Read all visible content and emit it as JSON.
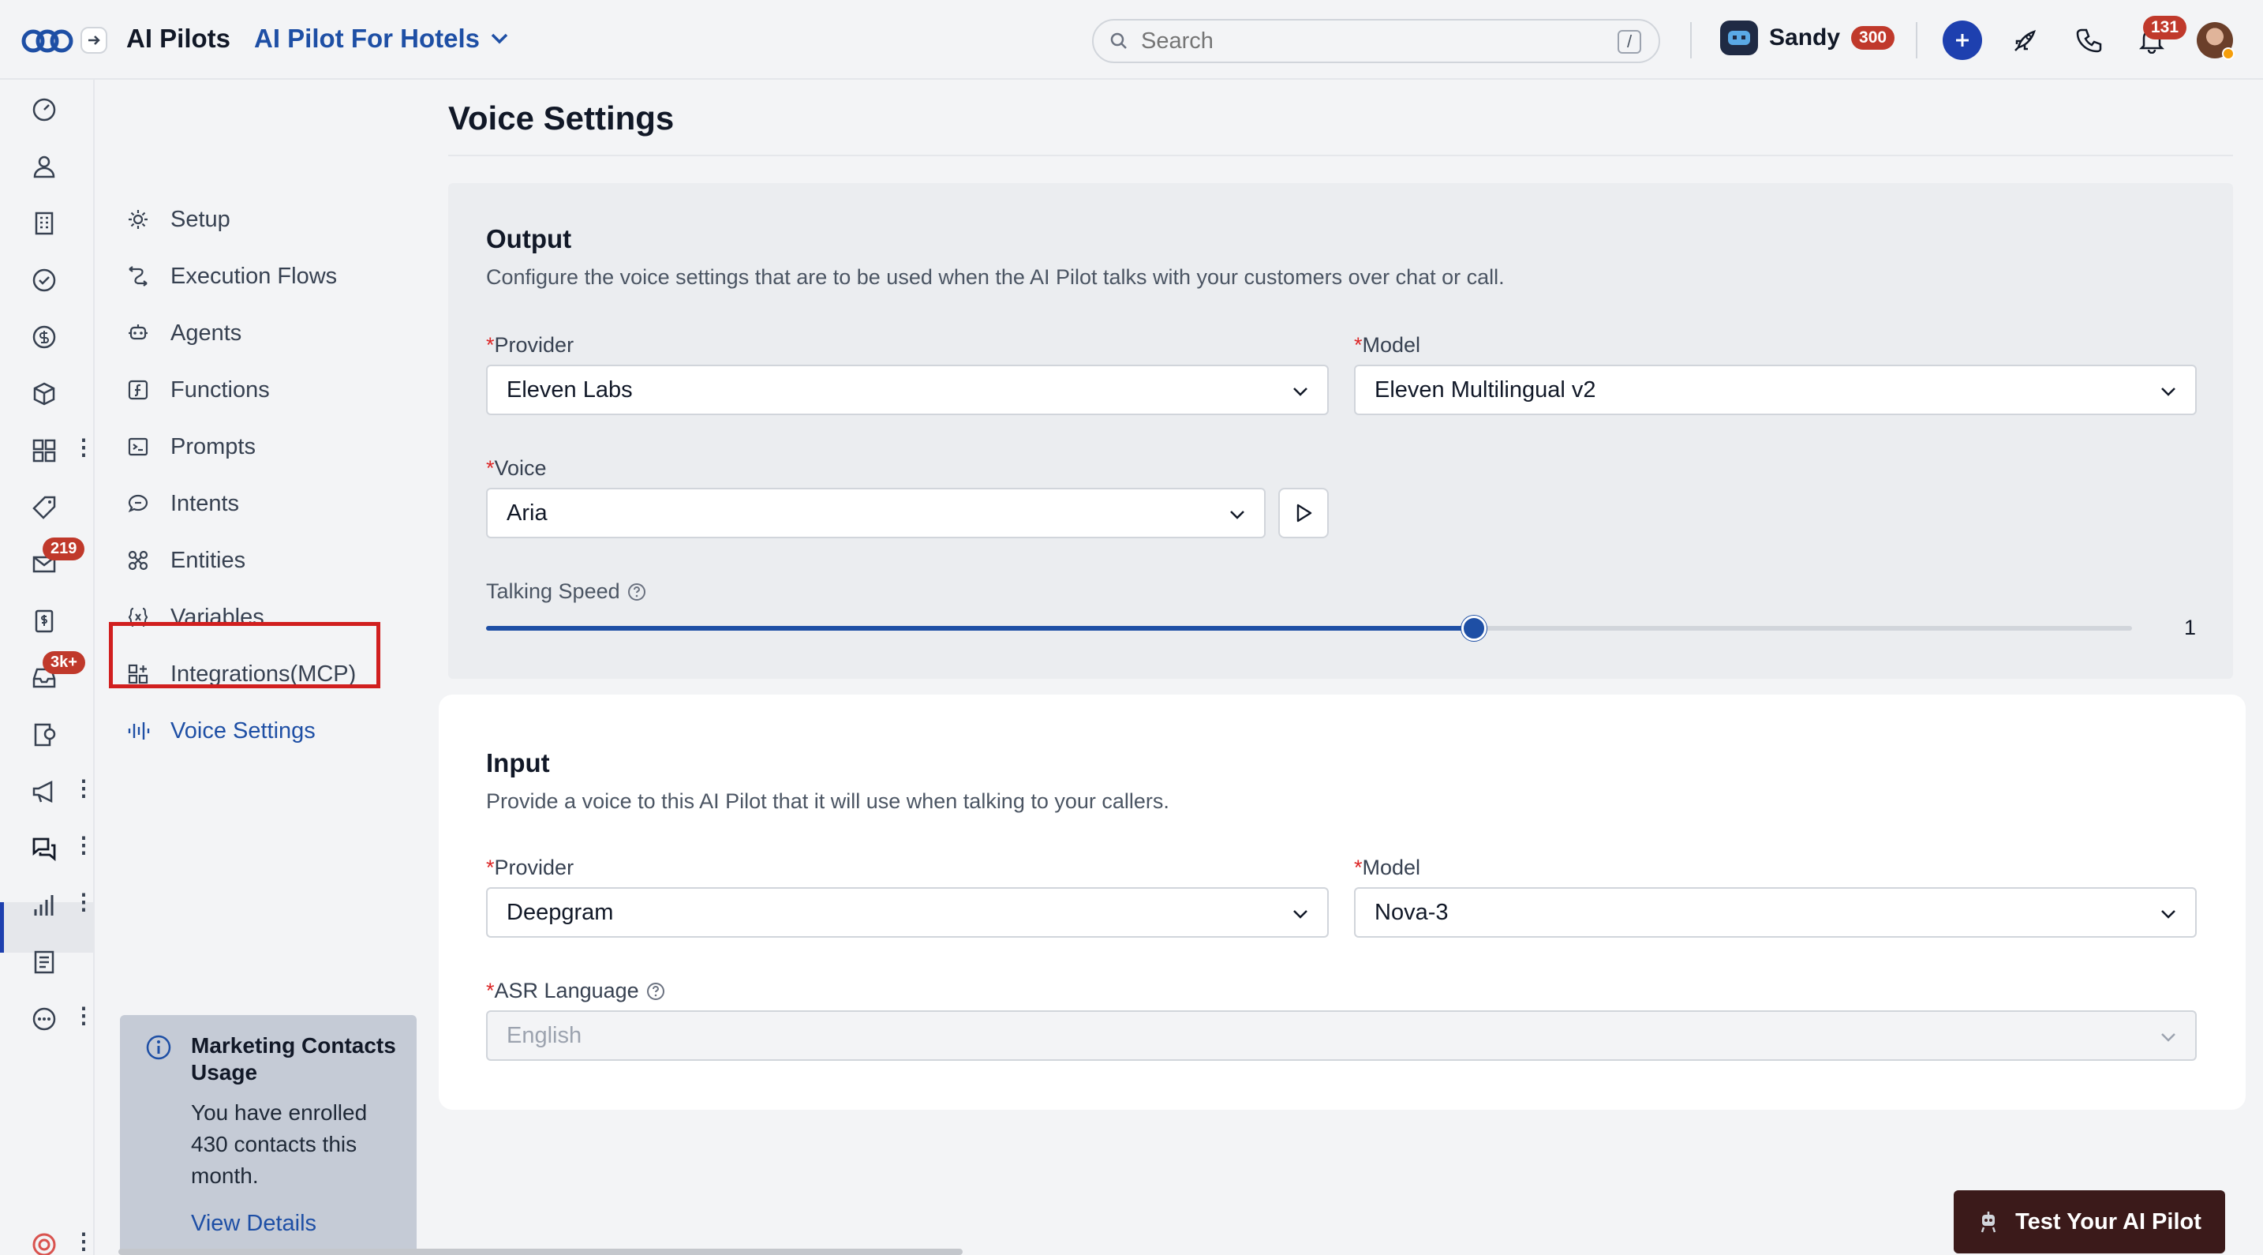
{
  "header": {
    "app_title": "AI Pilots",
    "pilot_name": "AI Pilot For Hotels",
    "search_placeholder": "Search",
    "search_shortcut": "/",
    "user_name": "Sandy",
    "user_badge": "300",
    "notifications_count": "131"
  },
  "rail": {
    "badges": {
      "mail": "219",
      "inbox": "3k+"
    }
  },
  "subnav": {
    "items": [
      {
        "label": "Setup",
        "icon": "gear-icon"
      },
      {
        "label": "Execution Flows",
        "icon": "flow-icon"
      },
      {
        "label": "Agents",
        "icon": "agent-icon"
      },
      {
        "label": "Functions",
        "icon": "function-icon"
      },
      {
        "label": "Prompts",
        "icon": "prompt-icon"
      },
      {
        "label": "Intents",
        "icon": "intent-icon"
      },
      {
        "label": "Entities",
        "icon": "entity-icon"
      },
      {
        "label": "Variables",
        "icon": "variable-icon"
      },
      {
        "label": "Integrations(MCP)",
        "icon": "integrations-icon"
      },
      {
        "label": "Voice Settings",
        "icon": "voice-icon"
      }
    ],
    "active_index": 9
  },
  "usage_card": {
    "title": "Marketing Contacts Usage",
    "body": "You have enrolled 430 contacts this month.",
    "link": "View Details"
  },
  "page": {
    "title": "Voice Settings"
  },
  "output": {
    "title": "Output",
    "description": "Configure the voice settings that are to be used when the AI Pilot talks with your customers over chat or call.",
    "provider_label": "Provider",
    "provider_value": "Eleven Labs",
    "model_label": "Model",
    "model_value": "Eleven Multilingual v2",
    "voice_label": "Voice",
    "voice_value": "Aria",
    "speed_label": "Talking Speed",
    "speed_value": "1",
    "speed_fraction": 0.6
  },
  "input": {
    "title": "Input",
    "description": "Provide a voice to this AI Pilot that it will use when talking to your callers.",
    "provider_label": "Provider",
    "provider_value": "Deepgram",
    "model_label": "Model",
    "model_value": "Nova-3",
    "asr_label": "ASR Language",
    "asr_value": "English"
  },
  "required_marker": "*",
  "test_button": "Test Your AI Pilot",
  "colors": {
    "accent": "#1e4fa5",
    "badge": "#c0392b",
    "highlight": "#d11f1f",
    "test_button_bg": "#3b1a1a"
  }
}
